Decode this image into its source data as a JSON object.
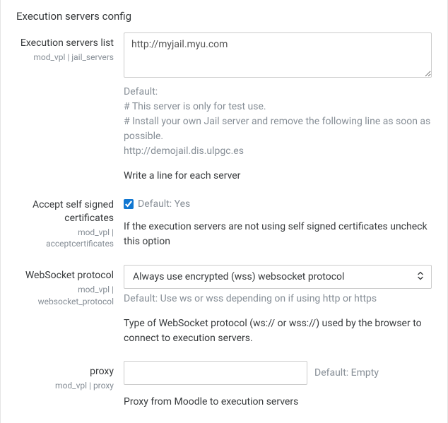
{
  "section_title": "Execution servers config",
  "fields": {
    "servers_list": {
      "label": "Execution servers list",
      "sublabel": "mod_vpl | jail_servers",
      "value": "http://myjail.myu.com",
      "default_heading": "Default:",
      "default_lines": [
        "# This server is only for test use.",
        "# Install your own Jail server and remove the following line as soon as possible.",
        "http://demojail.dis.ulpgc.es"
      ],
      "description": "Write a line for each server"
    },
    "accept_cert": {
      "label": "Accept self signed certificates",
      "sublabel": "mod_vpl | acceptcertificates",
      "checked": true,
      "default_label": "Default: Yes",
      "description": "If the execution servers are not using self signed certificates uncheck this option"
    },
    "ws_protocol": {
      "label": "WebSocket protocol",
      "sublabel": "mod_vpl | websocket_protocol",
      "selected": "Always use encrypted (wss) websocket protocol",
      "default_text": "Default: Use ws or wss depending on if using http or https",
      "description": "Type of WebSocket protocol (ws:// or wss://) used by the browser to connect to execution servers."
    },
    "proxy": {
      "label": "proxy",
      "sublabel": "mod_vpl | proxy",
      "value": "",
      "default_label": "Default: Empty",
      "description": "Proxy from Moodle to execution servers"
    }
  }
}
